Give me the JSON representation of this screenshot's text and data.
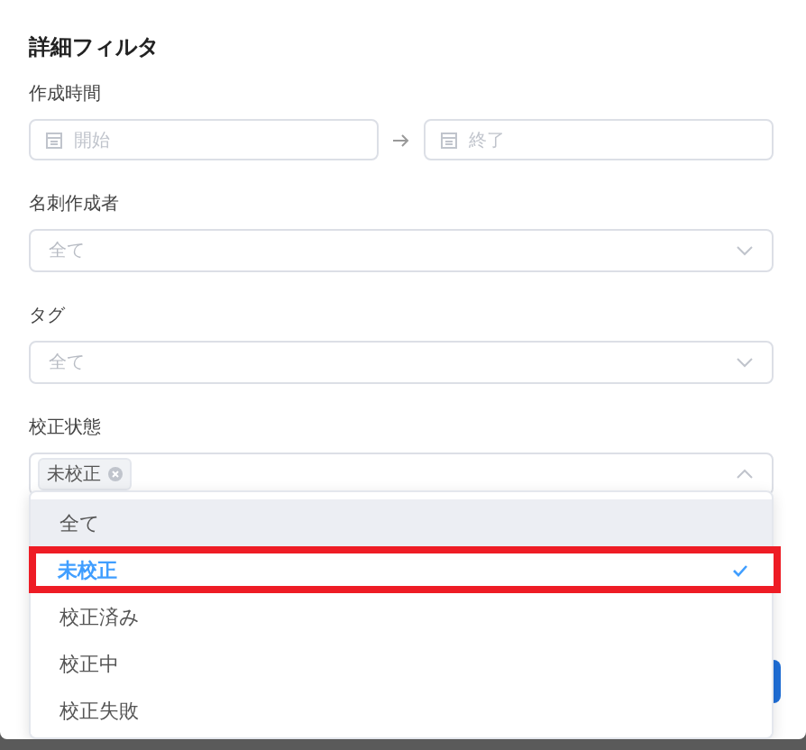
{
  "dialog": {
    "title": "詳細フィルタ"
  },
  "date_range": {
    "label": "作成時間",
    "start_placeholder": "開始",
    "end_placeholder": "終了"
  },
  "selects": [
    {
      "label": "名刺作成者",
      "value": "全て",
      "open": false
    },
    {
      "label": "タグ",
      "value": "全て",
      "open": false
    }
  ],
  "status_select": {
    "label": "校正状態",
    "tags": [
      "未校正"
    ],
    "open": true
  },
  "dropdown": {
    "options": [
      {
        "label": "全て",
        "selected": false,
        "hovered": true,
        "highlighted": false
      },
      {
        "label": "未校正",
        "selected": true,
        "hovered": false,
        "highlighted": true
      },
      {
        "label": "校正済み",
        "selected": false,
        "hovered": false,
        "highlighted": false
      },
      {
        "label": "校正中",
        "selected": false,
        "hovered": false,
        "highlighted": false
      },
      {
        "label": "校正失敗",
        "selected": false,
        "hovered": false,
        "highlighted": false
      }
    ]
  }
}
